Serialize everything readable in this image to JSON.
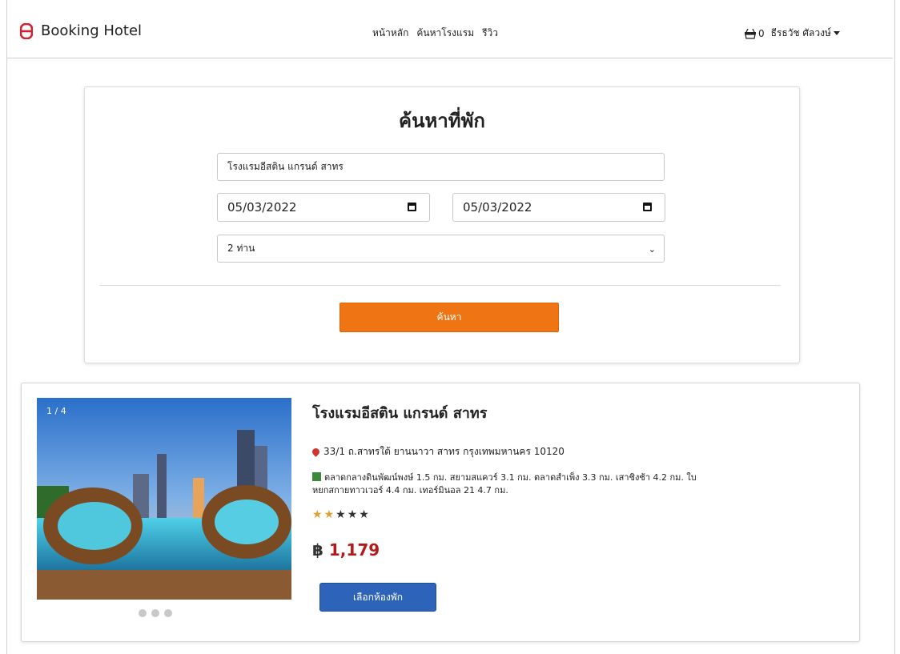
{
  "navbar": {
    "brand": "Booking Hotel",
    "links": [
      "หน้าหลัก",
      "ค้นหาโรงแรม",
      "รีวิว"
    ],
    "cart_count": "0",
    "user_name": "ธีรธวัช ศัลวงษ์"
  },
  "search": {
    "title": "ค้นหาที่พัก",
    "hotel_value": "โรงแรมอีสติน แกรนด์ สาทร",
    "checkin": "05/03/2022",
    "checkout": "05/03/2022",
    "guests": "2 ท่าน",
    "button": "ค้นหา"
  },
  "result": {
    "photo_counter": "1 / 4",
    "name": "โรงแรมอีสติน แกรนด์ สาทร",
    "address": "33/1 ถ.สาทรใต้ ยานนาวา สาทร กรุงเทพมหานคร 10120",
    "nearby": "ตลาดกลางดินพัฒน์พงษ์ 1.5 กม. สยามสแควร์ 3.1 กม. ตลาดสำเพ็ง 3.3 กม. เสาชิงช้า 4.2 กม. ใบหยกสกายทาวเวอร์ 4.4 กม. เทอร์มินอล 21 4.7 กม.",
    "rating": 2,
    "rating_max": 5,
    "currency": "฿",
    "price": "1,179",
    "button": "เลือกห้องพัก"
  },
  "colors": {
    "accent_orange": "#ef7514",
    "accent_blue": "#2d63b8",
    "price_red": "#b51a1a",
    "brand_red": "#d3202e"
  }
}
